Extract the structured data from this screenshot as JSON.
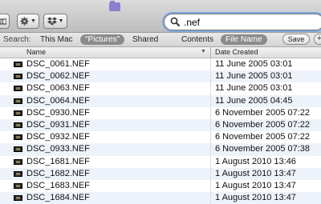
{
  "toolbar": {
    "view_button_icon": "column-view-icon",
    "action_button_icon": "gear-icon",
    "dropbox_button_icon": "dropbox-icon",
    "window_folder_icon": "folder-icon",
    "search": {
      "value": ".nef",
      "icon": "magnifier-icon"
    }
  },
  "scope_bar": {
    "label": "Search:",
    "items": [
      {
        "label": "This Mac",
        "selected": false
      },
      {
        "label": "\"Pictures\"",
        "selected": true
      },
      {
        "label": "Shared",
        "selected": false
      }
    ],
    "attributes": [
      {
        "label": "Contents",
        "selected": false
      },
      {
        "label": "File Name",
        "selected": true
      }
    ],
    "save_label": "Save",
    "add_label": "+"
  },
  "columns": {
    "name": "Name",
    "date_created": "Date Created",
    "sort_indicator": "▼"
  },
  "rows": [
    {
      "name": "DSC_0061.NEF",
      "date": "11 June 2005 03:01"
    },
    {
      "name": "DSC_0062.NEF",
      "date": "11 June 2005 03:01"
    },
    {
      "name": "DSC_0063.NEF",
      "date": "11 June 2005 03:01"
    },
    {
      "name": "DSC_0064.NEF",
      "date": "11 June 2005 04:45"
    },
    {
      "name": "DSC_0930.NEF",
      "date": "6 November 2005 07:22"
    },
    {
      "name": "DSC_0931.NEF",
      "date": "6 November 2005 07:22"
    },
    {
      "name": "DSC_0932.NEF",
      "date": "6 November 2005 07:22"
    },
    {
      "name": "DSC_0933.NEF",
      "date": "6 November 2005 07:38"
    },
    {
      "name": "DSC_1681.NEF",
      "date": "1 August 2010 13:46"
    },
    {
      "name": "DSC_1682.NEF",
      "date": "1 August 2010 13:47"
    },
    {
      "name": "DSC_1683.NEF",
      "date": "1 August 2010 13:47"
    },
    {
      "name": "DSC_1684.NEF",
      "date": "1 August 2010 13:47"
    }
  ],
  "colors": {
    "selected_pill": "#8b8b8b",
    "focus_ring": "#7fa9dd",
    "row_alt": "#eef3fb"
  }
}
